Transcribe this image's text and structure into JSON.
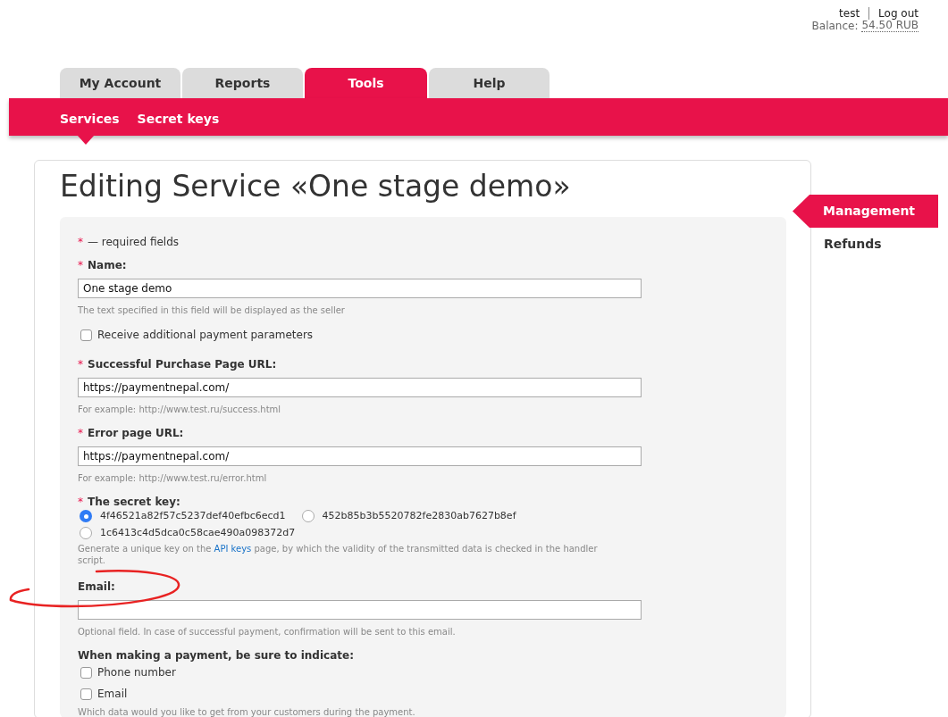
{
  "user": {
    "name": "test",
    "logout": "Log out",
    "balance_label": "Balance:",
    "balance_value": "54.50 RUB"
  },
  "tabs": [
    {
      "label": "My Account",
      "selected": false
    },
    {
      "label": "Reports",
      "selected": false
    },
    {
      "label": "Tools",
      "selected": true
    },
    {
      "label": "Help",
      "selected": false
    }
  ],
  "subnav": [
    {
      "label": "Services",
      "selected": true
    },
    {
      "label": "Secret keys",
      "selected": false
    }
  ],
  "title": "Editing Service «One stage demo»",
  "required_mark": "*",
  "required_note": "— required fields",
  "fields": [
    {
      "kind": "text",
      "required": true,
      "label": "Name:",
      "value": "One stage demo",
      "hint": "The text specified in this field will be displayed as the seller"
    },
    {
      "kind": "checkbox",
      "label": "Receive additional payment parameters",
      "checked": false
    },
    {
      "kind": "text",
      "required": true,
      "label": "Successful Purchase Page URL:",
      "value": "https://paymentnepal.com/",
      "hint": "For example: http://www.test.ru/success.html"
    },
    {
      "kind": "text",
      "required": true,
      "label": "Error page URL:",
      "value": "https://paymentnepal.com/",
      "hint": "For example: http://www.test.ru/error.html"
    },
    {
      "kind": "radio",
      "required": true,
      "label": "The secret key:",
      "options": [
        {
          "label": "4f46521a82f57c5237def40efbc6ecd1",
          "selected": true
        },
        {
          "label": "452b85b3b5520782fe2830ab7627b8ef",
          "selected": false
        },
        {
          "label": "1c6413c4d5dca0c58cae490a098372d7",
          "selected": false
        }
      ],
      "hint_before": "Generate a unique key on the",
      "hint_link": "API keys",
      "hint_after": "page, by which the validity of the transmitted data is checked in the handler script."
    },
    {
      "kind": "text",
      "required": false,
      "label": "Email:",
      "hint": "Optional field. In case of successful payment, confirmation will be sent to this email."
    },
    {
      "kind": "checkgroup",
      "required": false,
      "label": "When making a payment, be sure to indicate:",
      "options": [
        {
          "label": "Phone number",
          "checked": false
        },
        {
          "label": "Email",
          "checked": false
        }
      ],
      "hint": "Which data would you like to get from your customers during the payment."
    }
  ],
  "side_menu": [
    {
      "label": "Management",
      "selected": true
    },
    {
      "label": "Refunds",
      "selected": false
    }
  ]
}
